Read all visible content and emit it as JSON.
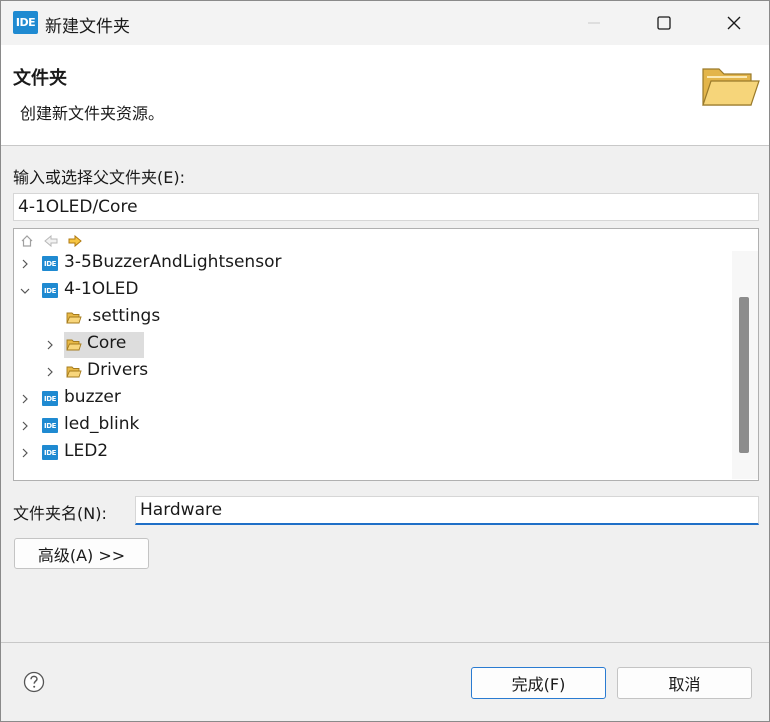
{
  "window": {
    "app_icon_text": "IDE",
    "title": "新建文件夹"
  },
  "banner": {
    "title": "文件夹",
    "description": "创建新文件夹资源。"
  },
  "parent_folder": {
    "label": "输入或选择父文件夹(E):",
    "value": "4-1OLED/Core"
  },
  "tree": {
    "items": [
      {
        "label": "3-5BuzzerAndLightsensor",
        "type": "project",
        "expand": "collapsed"
      },
      {
        "label": "4-1OLED",
        "type": "project",
        "expand": "expanded"
      },
      {
        "label": ".settings",
        "type": "folder",
        "expand": "none"
      },
      {
        "label": "Core",
        "type": "folder",
        "expand": "collapsed",
        "selected": true
      },
      {
        "label": "Drivers",
        "type": "folder",
        "expand": "collapsed"
      },
      {
        "label": "buzzer",
        "type": "project",
        "expand": "collapsed"
      },
      {
        "label": "led_blink",
        "type": "project",
        "expand": "collapsed"
      },
      {
        "label": "LED2",
        "type": "project",
        "expand": "collapsed"
      }
    ]
  },
  "folder_name": {
    "label": "文件夹名(N):",
    "value": "Hardware"
  },
  "buttons": {
    "advanced": "高级(A) >>",
    "finish": "完成(F)",
    "cancel": "取消"
  },
  "icons": {
    "help": "help-icon",
    "minimize": "minimize-icon",
    "maximize": "maximize-icon",
    "close": "close-icon",
    "home": "home-icon",
    "back": "back-arrow-icon",
    "forward": "forward-arrow-icon",
    "banner": "open-folder-icon"
  },
  "colors": {
    "accent": "#1f6fc7",
    "project_icon": "#1f8ad1",
    "folder": "#f3c75a",
    "selection": "#dddddd"
  }
}
